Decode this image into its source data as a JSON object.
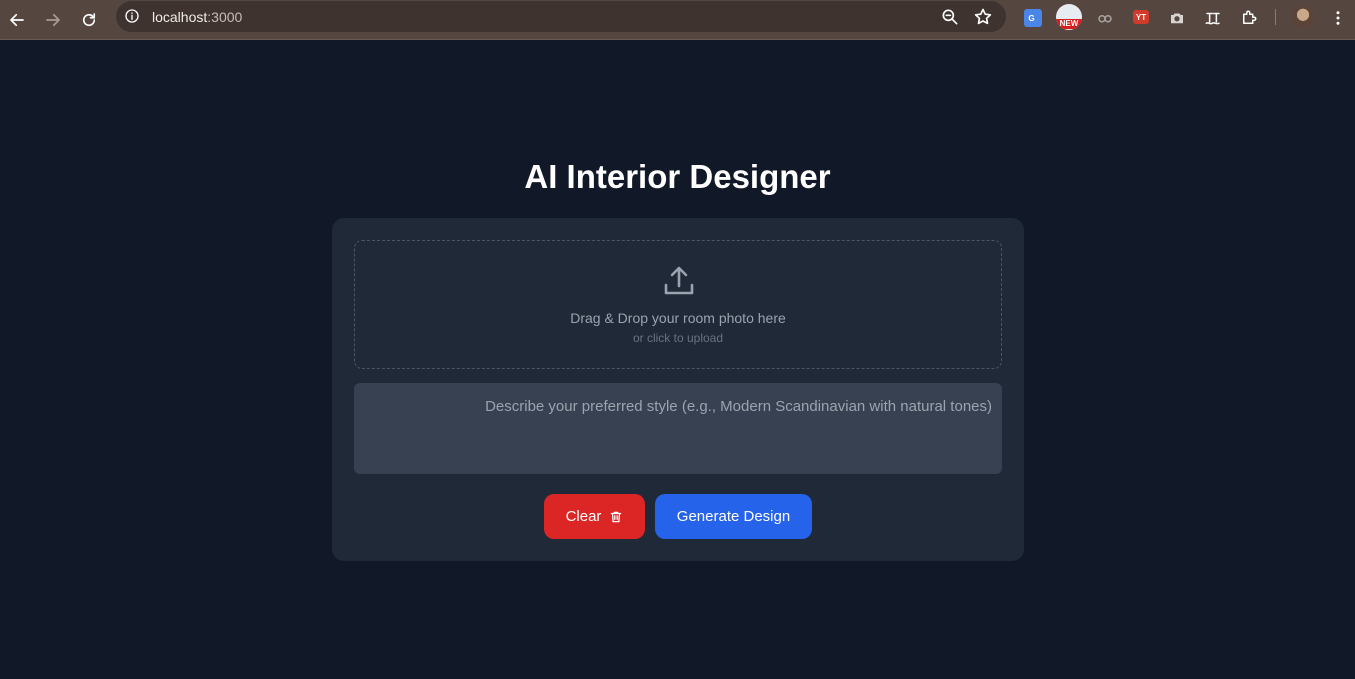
{
  "browser": {
    "url_host": "localhost",
    "url_port": ":3000",
    "new_badge": "NEW",
    "yt_ext_label": "YT",
    "icons": [
      "back-icon",
      "forward-icon",
      "reload-icon",
      "info-icon",
      "zoom-icon",
      "star-icon",
      "translate-icon",
      "extension-icon",
      "camera-icon",
      "puzzle-icon",
      "menu-icon"
    ]
  },
  "page": {
    "title": "AI Interior Designer"
  },
  "dropzone": {
    "primary_text": "Drag & Drop your room photo here",
    "secondary_text": "or click to upload"
  },
  "style_input": {
    "value": "",
    "placeholder": "Describe your preferred style (e.g., Modern Scandinavian with natural tones)"
  },
  "actions": {
    "clear_label": "Clear",
    "generate_label": "Generate Design"
  },
  "colors": {
    "page_bg": "#111827",
    "card_bg": "#1f2937",
    "input_bg": "#374151",
    "clear_button": "#dc2626",
    "generate_button": "#2563eb"
  }
}
